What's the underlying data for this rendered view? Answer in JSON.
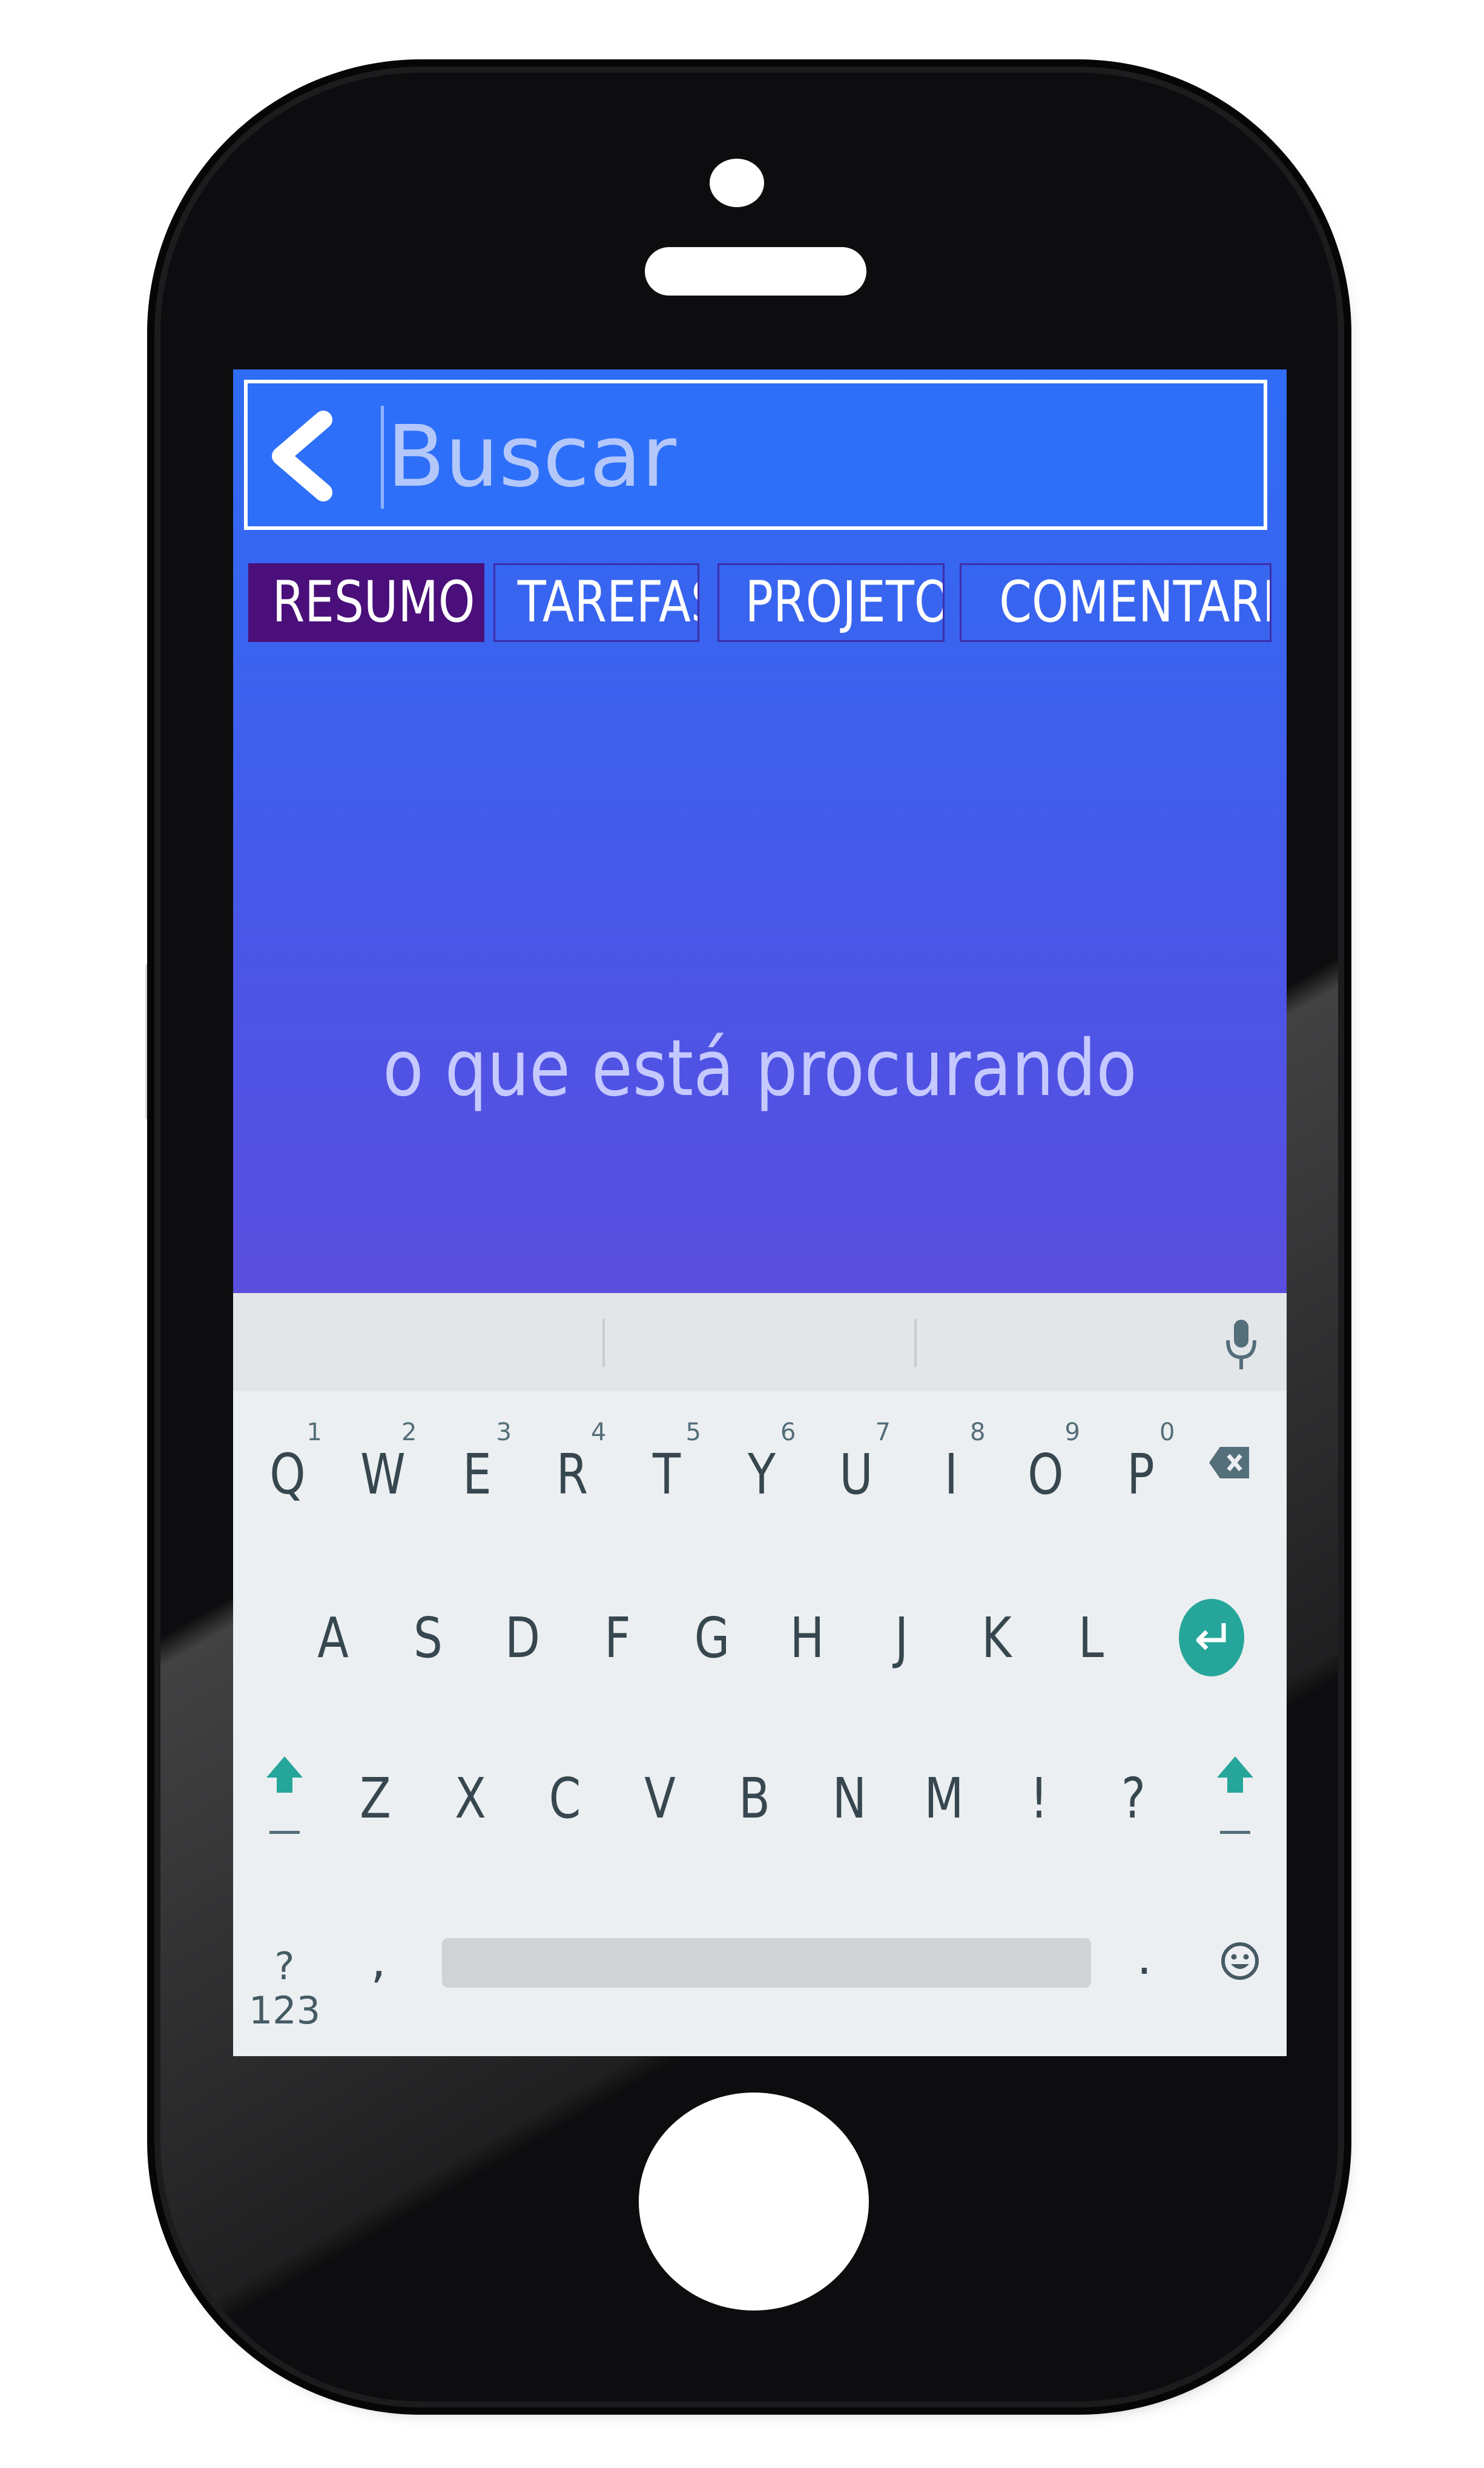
{
  "search": {
    "placeholder": "Buscar",
    "value": ""
  },
  "tabs": [
    {
      "label": "RESUMO",
      "active": true
    },
    {
      "label": "TAREFAS",
      "active": false
    },
    {
      "label": "PROJETOS",
      "active": false
    },
    {
      "label": "COMENTARIOS",
      "active": false
    }
  ],
  "empty_state": {
    "text": "o que está procurando"
  },
  "keyboard": {
    "row1": [
      "Q",
      "W",
      "E",
      "R",
      "T",
      "Y",
      "U",
      "I",
      "O",
      "P"
    ],
    "row1_numbers": [
      "1",
      "2",
      "3",
      "4",
      "5",
      "6",
      "7",
      "8",
      "9",
      "0"
    ],
    "row2": [
      "A",
      "S",
      "D",
      "F",
      "G",
      "H",
      "J",
      "K",
      "L"
    ],
    "row3": [
      "Z",
      "X",
      "C",
      "V",
      "B",
      "N",
      "M",
      "!",
      "?"
    ],
    "symbols_label": "?123",
    "comma": ",",
    "period": "."
  },
  "colors": {
    "header_top": "#2f6df6",
    "header_bottom": "#5a4ede",
    "active_tab": "#4a0f7a",
    "keyboard_bg": "#eceff1",
    "keyboard_accent": "#26a69a",
    "key_text": "#37474f"
  },
  "icons": [
    "back-arrow-icon",
    "microphone-icon",
    "backspace-icon",
    "enter-icon",
    "shift-icon",
    "emoji-icon"
  ]
}
